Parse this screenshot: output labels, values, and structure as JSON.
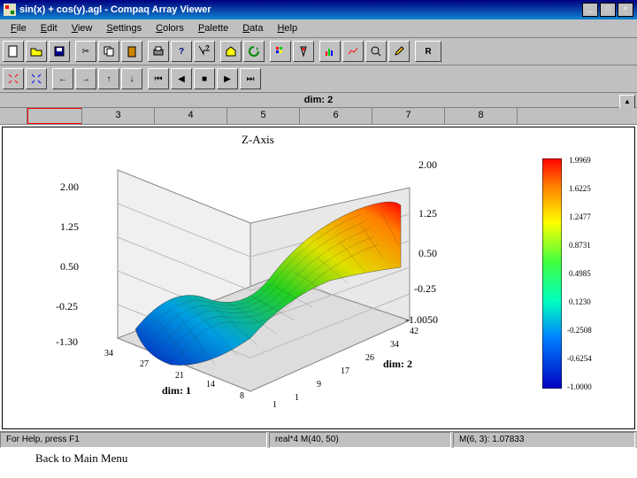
{
  "window": {
    "title": "sin(x) + cos(y).agl - Compaq Array Viewer"
  },
  "menu": [
    "File",
    "Edit",
    "View",
    "Settings",
    "Colors",
    "Palette",
    "Data",
    "Help"
  ],
  "dim_header": "dim: 2",
  "columns": [
    "3",
    "4",
    "5",
    "6",
    "7",
    "8"
  ],
  "chart_data": {
    "type": "surface3d",
    "title": "Z-Axis",
    "z_ticks_left": [
      "2.00",
      "1.25",
      "0.50",
      "-0.25",
      "-1.30"
    ],
    "z_ticks_right": [
      "2.00",
      "1.25",
      "0.50",
      "-0.25",
      "-1.0050"
    ],
    "x_ticks": [
      "34",
      "27",
      "21",
      "14",
      "8",
      "1"
    ],
    "y_ticks": [
      "42",
      "34",
      "26",
      "17",
      "9",
      "1"
    ],
    "xlabel": "dim: 1",
    "ylabel": "dim: 2",
    "colorbar": [
      "1.9969",
      "1.6225",
      "1.2477",
      "0.8731",
      "0.4985",
      "0.1230",
      "-0.2508",
      "-0.6254",
      "-1.0000"
    ],
    "function": "sin(x)+cos(y)",
    "x_count": 40,
    "y_count": 50,
    "z_min": -1.0,
    "z_max": 2.0
  },
  "status": {
    "help": "For Help, press F1",
    "type": "real*4 M(40, 50)",
    "cursor": "M(6, 3): 1.07833"
  },
  "footer_link": "Back to Main Menu"
}
